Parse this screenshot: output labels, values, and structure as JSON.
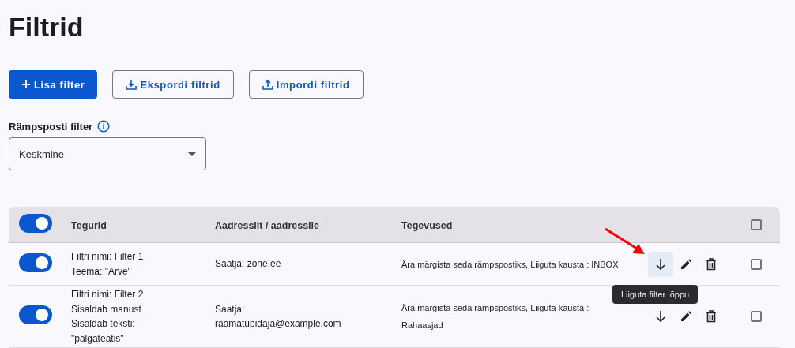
{
  "title": "Filtrid",
  "toolbar": [
    {
      "kind": "add",
      "label": "Lisa filter"
    },
    {
      "kind": "export",
      "label": "Ekspordi filtrid"
    },
    {
      "kind": "import",
      "label": "Impordi filtrid"
    }
  ],
  "spam_filter": {
    "label": "Rämpsposti filter",
    "value": "Keskmine"
  },
  "table": {
    "header_toggle_on": true,
    "header_checked": false,
    "columns": [
      "Tegurid",
      "Aadressilt / aadressile",
      "Tegevused"
    ],
    "rows": [
      {
        "on": true,
        "conditions": [
          "Filtri nimi: Filter 1",
          "Teema: \"Arve\""
        ],
        "address": [
          "Saatja: zone.ee"
        ],
        "actions": [
          "Ära märgista seda rämpspostiks, Liiguta kausta : INBOX"
        ],
        "move_hovered": true,
        "tooltip": "Liiguta filter lõppu",
        "checked": false
      },
      {
        "on": true,
        "conditions": [
          "Filtri nimi: Filter 2",
          "Sisaldab manust",
          "Sisaldab teksti:",
          "\"palgateatis\""
        ],
        "address": [
          "Saatja:",
          "raamatupidaja@example.com"
        ],
        "actions": [
          "Ära märgista seda rämpspostiks, Liiguta kausta :",
          "Rahaasjad"
        ],
        "move_hovered": false,
        "checked": false
      }
    ]
  }
}
